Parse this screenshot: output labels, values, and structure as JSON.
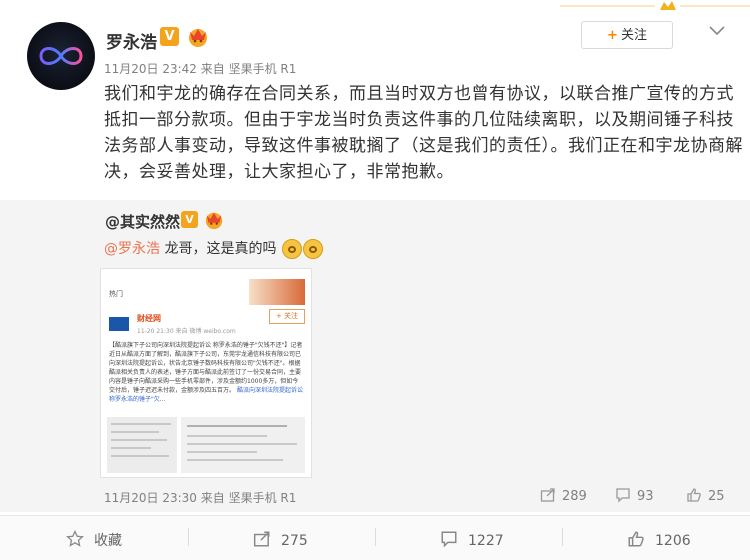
{
  "author": {
    "name": "罗永浩",
    "verified_badge": "V",
    "follow_label": "关注",
    "follow_plus": "+"
  },
  "post": {
    "timestamp": "11月20日 23:42",
    "source": "来自 坚果手机 R1",
    "text": "我们和宇龙的确存在合同关系，而且当时双方也曾有协议，以联合推广宣传的方式抵扣一部分款项。但由于宇龙当时负责这件事的几位陆续离职，以及期间锤子科技法务部人事变动，导致这件事被耽搁了（这是我们的责任）。我们正在和宇龙协商解决，会妥善处理，让大家担心了，非常抱歉。"
  },
  "repost": {
    "author": "@其实然然",
    "verified_badge": "V",
    "mention": "@罗永浩",
    "text": " 龙哥，这是真的吗",
    "timestamp": "11月20日 23:30",
    "source": "来自 坚果手机 R1",
    "thumbnail": {
      "section": "热门",
      "source_name": "财经网",
      "source_meta": "11-20 21:30  来自 微博 weibo.com",
      "follow": "+ 关注",
      "body": "【酷派旗下子公司向深圳法院提起诉讼 称罗永浩的锤子\"欠钱不还\"】记者近日从酷派方面了解到，酷派旗下子公司，东莞宇龙通信科技有限公司已向深圳法院提起诉讼，状告北京锤子数码科技有限公司\"欠钱不还\"。根据酷派相关负责人的表述，锤子方面与酷派此前签订了一份交易合同，主要内容是锤子向酷派采购一些手机零部件，涉及金额约1000多万，但如今交付后，锤子迟迟未付款，金额涉及四五百万。",
      "link": "酷派向深圳法院提起诉讼 称罗永浩的锤子\"欠..."
    },
    "stats": {
      "reposts": "289",
      "comments": "93",
      "likes": "25"
    }
  },
  "actions": {
    "collect": "收藏",
    "forward": "275",
    "comment": "1227",
    "like": "1206"
  },
  "colors": {
    "accent": "#ff8200",
    "mention": "#eb7350",
    "verified": "#f3a31c",
    "meta_gray": "#808080"
  }
}
